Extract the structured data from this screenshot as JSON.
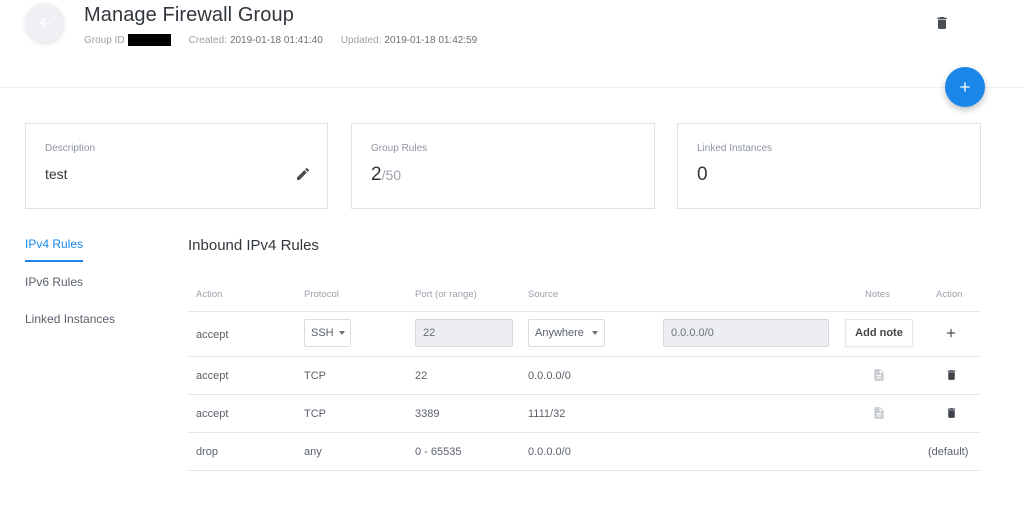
{
  "header": {
    "title": "Manage Firewall Group",
    "group_id_label": "Group ID",
    "created_label": "Created:",
    "created_value": "2019-01-18 01:41:40",
    "updated_label": "Updated:",
    "updated_value": "2019-01-18 01:42:59"
  },
  "cards": {
    "description": {
      "label": "Description",
      "value": "test"
    },
    "group_rules": {
      "label": "Group Rules",
      "count": "2",
      "max": "/50"
    },
    "linked_instances": {
      "label": "Linked Instances",
      "value": "0"
    }
  },
  "nav": {
    "items": [
      {
        "label": "IPv4 Rules",
        "active": true
      },
      {
        "label": "IPv6 Rules",
        "active": false
      },
      {
        "label": "Linked Instances",
        "active": false
      }
    ]
  },
  "table": {
    "title": "Inbound IPv4 Rules",
    "columns": [
      "Action",
      "Protocol",
      "Port (or range)",
      "Source",
      "Notes",
      "Action"
    ],
    "new_rule": {
      "action": "accept",
      "protocol": "SSH",
      "port": "22",
      "source_type": "Anywhere",
      "source_value": "0.0.0.0/0",
      "add_note_label": "Add note"
    },
    "rows": [
      {
        "action": "accept",
        "protocol": "TCP",
        "port": "22",
        "source": "0.0.0.0/0"
      },
      {
        "action": "accept",
        "protocol": "TCP",
        "port": "3389",
        "source": "1111/32"
      },
      {
        "action": "drop",
        "protocol": "any",
        "port": "0 - 65535",
        "source": "0.0.0.0/0",
        "default_label": "(default)"
      }
    ]
  },
  "colors": {
    "accent": "#1a86e8",
    "text_dark": "#32373e",
    "text_muted": "#9aa1ab",
    "border": "#dfe3e8"
  },
  "icons": {
    "back": "arrow-left-icon",
    "delete_group": "trash-icon",
    "add": "plus-icon",
    "edit": "pencil-icon",
    "note": "document-icon",
    "delete_rule": "trash-icon"
  }
}
